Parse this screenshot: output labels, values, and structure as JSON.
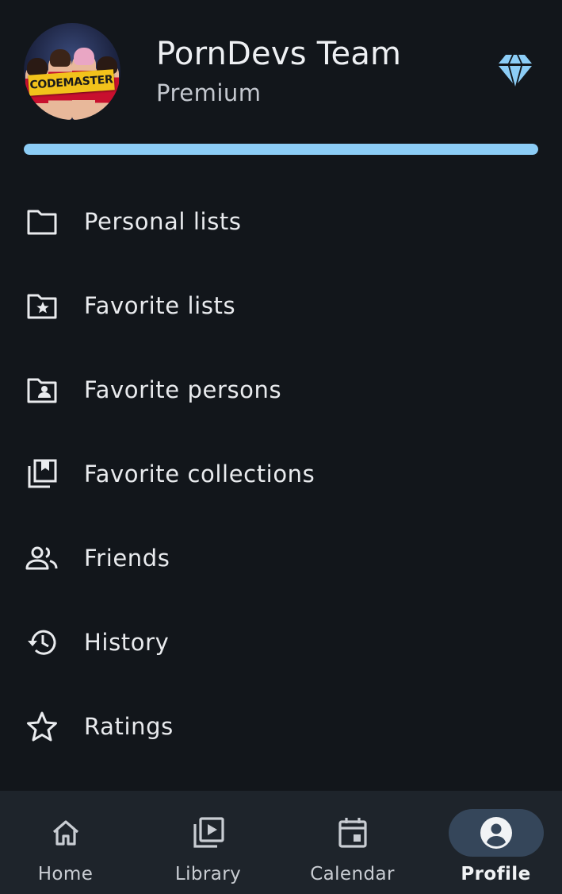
{
  "profile": {
    "name": "PornDevs Team",
    "plan": "Premium",
    "avatar_badge": "CODEMASTER",
    "progress_fraction": 1.0
  },
  "colors": {
    "background": "#12161b",
    "accent": "#8ccdf6",
    "nav_background": "#1e242b",
    "nav_active_pill": "#35465a"
  },
  "menu": {
    "items": [
      {
        "label": "Personal lists",
        "icon": "folder-icon"
      },
      {
        "label": "Favorite lists",
        "icon": "folder-star-icon"
      },
      {
        "label": "Favorite persons",
        "icon": "folder-person-icon"
      },
      {
        "label": "Favorite collections",
        "icon": "bookmark-stack-icon"
      },
      {
        "label": "Friends",
        "icon": "people-icon"
      },
      {
        "label": "History",
        "icon": "history-icon"
      },
      {
        "label": "Ratings",
        "icon": "star-icon"
      }
    ]
  },
  "nav": {
    "items": [
      {
        "label": "Home",
        "icon": "home-icon",
        "active": false
      },
      {
        "label": "Library",
        "icon": "library-icon",
        "active": false
      },
      {
        "label": "Calendar",
        "icon": "calendar-icon",
        "active": false
      },
      {
        "label": "Profile",
        "icon": "account-icon",
        "active": true
      }
    ]
  }
}
